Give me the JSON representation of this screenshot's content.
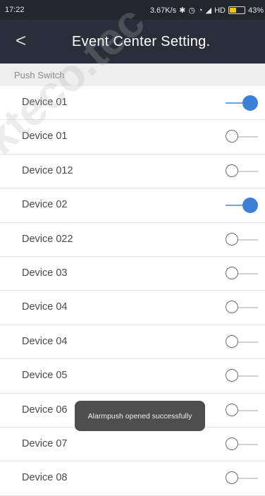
{
  "status_bar": {
    "time": "17:22",
    "net_speed": "3.67K/s",
    "network": "HD",
    "battery": "43%",
    "battery_level": 0.43
  },
  "header": {
    "back_icon": "chevron-left-icon",
    "title": "Event Center Setting."
  },
  "section": {
    "title": "Push Switch"
  },
  "devices": [
    {
      "name": "Device 01",
      "enabled": true
    },
    {
      "name": "Device 01",
      "enabled": false
    },
    {
      "name": "Device 012",
      "enabled": false
    },
    {
      "name": "Device 02",
      "enabled": true
    },
    {
      "name": "Device 022",
      "enabled": false
    },
    {
      "name": "Device 03",
      "enabled": false
    },
    {
      "name": "Device 04",
      "enabled": false
    },
    {
      "name": "Device 04",
      "enabled": false
    },
    {
      "name": "Device 05",
      "enabled": false
    },
    {
      "name": "Device 06",
      "enabled": false
    },
    {
      "name": "Device 07",
      "enabled": false
    },
    {
      "name": "Device 08",
      "enabled": false
    }
  ],
  "toast": {
    "message": "Alarmpush opened successfully"
  },
  "watermark": {
    "text": "zkteco.tec"
  },
  "colors": {
    "header_bg": "#2a2e3a",
    "accent": "#3d7ed6",
    "section_bg": "#eeeeee"
  }
}
